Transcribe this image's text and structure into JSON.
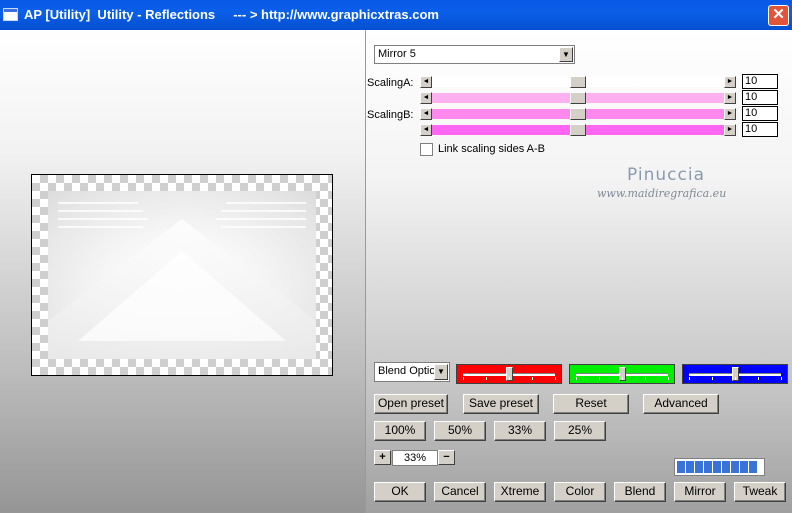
{
  "window": {
    "title": "AP [Utility]  Utility - Reflections     --- > http://www.graphicxtras.com",
    "close_glyph": "✕"
  },
  "mode_select": {
    "value": "Mirror 5"
  },
  "scaling": {
    "a_label": "ScalingA:",
    "b_label": "ScalingB:",
    "rows": [
      {
        "value": "10",
        "color": "#ffffff",
        "position": 0.5
      },
      {
        "value": "10",
        "color": "#ffb0f0",
        "position": 0.5
      },
      {
        "value": "10",
        "color": "#ff88ee",
        "position": 0.5
      },
      {
        "value": "10",
        "color": "#ff66f2",
        "position": 0.5
      }
    ]
  },
  "link_scaling": {
    "label": "Link scaling sides A-B",
    "checked": false
  },
  "watermark": {
    "name": "Pinuccia",
    "url": "www.maidiregrafica.eu"
  },
  "blend_options": {
    "value": "Blend Optio"
  },
  "color_sliders": [
    {
      "name": "red",
      "color": "#ff0000",
      "position": 0.5
    },
    {
      "name": "green",
      "color": "#00ee00",
      "position": 0.5
    },
    {
      "name": "blue",
      "color": "#0000ff",
      "position": 0.5
    }
  ],
  "buttons": {
    "open_preset": "Open preset",
    "save_preset": "Save preset",
    "reset": "Reset",
    "advanced": "Advanced",
    "zoom_100": "100%",
    "zoom_50": "50%",
    "zoom_33": "33%",
    "zoom_25": "25%",
    "ok": "OK",
    "cancel": "Cancel",
    "xtreme": "Xtreme",
    "color": "Color",
    "blend": "Blend",
    "mirror": "Mirror",
    "tweak": "Tweak"
  },
  "zoom": {
    "plus": "+",
    "minus": "−",
    "value": "33%"
  },
  "progress": {
    "segments": 9,
    "fraction": 1.0
  }
}
